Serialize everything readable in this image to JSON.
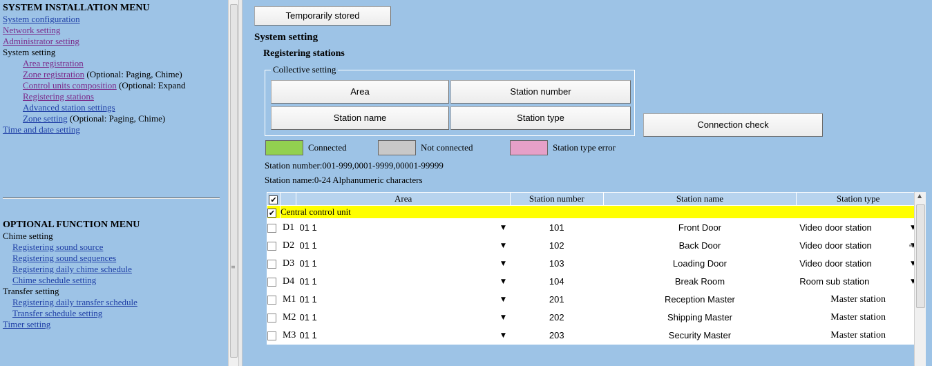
{
  "left_menu": {
    "title": "SYSTEM INSTALLATION MENU",
    "items": [
      {
        "label": "System configuration"
      },
      {
        "label": "Network setting"
      },
      {
        "label": "Administrator setting"
      },
      {
        "label": "System setting"
      },
      {
        "label": "Area registration"
      },
      {
        "label": "Zone registration",
        "note": "(Optional: Paging, Chime)"
      },
      {
        "label": "Control units composition",
        "note": "(Optional: Expand"
      },
      {
        "label": "Registering stations"
      },
      {
        "label": "Advanced station settings"
      },
      {
        "label": "Zone setting",
        "note": "(Optional: Paging, Chime)"
      },
      {
        "label": "Time and date setting"
      }
    ],
    "optional_title": "OPTIONAL FUNCTION MENU",
    "optional_items": [
      {
        "label": "Chime setting"
      },
      {
        "label": "Registering sound source"
      },
      {
        "label": "Registering sound sequences"
      },
      {
        "label": "Registering daily chime schedule"
      },
      {
        "label": "Chime schedule setting"
      },
      {
        "label": "Transfer setting"
      },
      {
        "label": "Registering daily transfer schedule"
      },
      {
        "label": "Transfer schedule setting"
      },
      {
        "label": "Timer setting"
      }
    ]
  },
  "main": {
    "temp_button": "Temporarily stored",
    "heading": "System setting",
    "subheading": "Registering stations",
    "collective_legend": "Collective setting",
    "buttons": {
      "area": "Area",
      "station_number": "Station number",
      "station_name": "Station name",
      "station_type": "Station type",
      "connection_check": "Connection check"
    },
    "legend": {
      "connected": "Connected",
      "not_connected": "Not connected",
      "type_error": "Station type error",
      "connected_color": "#92d050",
      "not_connected_color": "#c8c8c8",
      "type_error_color": "#e6a0c8"
    },
    "info_number": "Station number:001-999,0001-9999,00001-99999",
    "info_name": "Station name:0-24 Alphanumeric characters"
  },
  "table": {
    "headers": {
      "check": "✔",
      "area": "Area",
      "station_number": "Station number",
      "station_name": "Station name",
      "station_type": "Station type"
    },
    "group_check": "✔",
    "group_label": "Central control unit",
    "rows": [
      {
        "id": "D1",
        "area": "01 1",
        "number": "101",
        "name": "Front Door",
        "type": "Video door station",
        "type_select": true
      },
      {
        "id": "D2",
        "area": "01 1",
        "number": "102",
        "name": "Back Door",
        "type": "Video door station",
        "type_select": true
      },
      {
        "id": "D3",
        "area": "01 1",
        "number": "103",
        "name": "Loading Door",
        "type": "Video door station",
        "type_select": true
      },
      {
        "id": "D4",
        "area": "01 1",
        "number": "104",
        "name": "Break Room",
        "type": "Room sub station",
        "type_select": true
      },
      {
        "id": "M1",
        "area": "01 1",
        "number": "201",
        "name": "Reception Master",
        "type": "Master station",
        "type_select": false
      },
      {
        "id": "M2",
        "area": "01 1",
        "number": "202",
        "name": "Shipping Master",
        "type": "Master station",
        "type_select": false
      },
      {
        "id": "M3",
        "area": "01 1",
        "number": "203",
        "name": "Security Master",
        "type": "Master station",
        "type_select": false
      }
    ]
  }
}
